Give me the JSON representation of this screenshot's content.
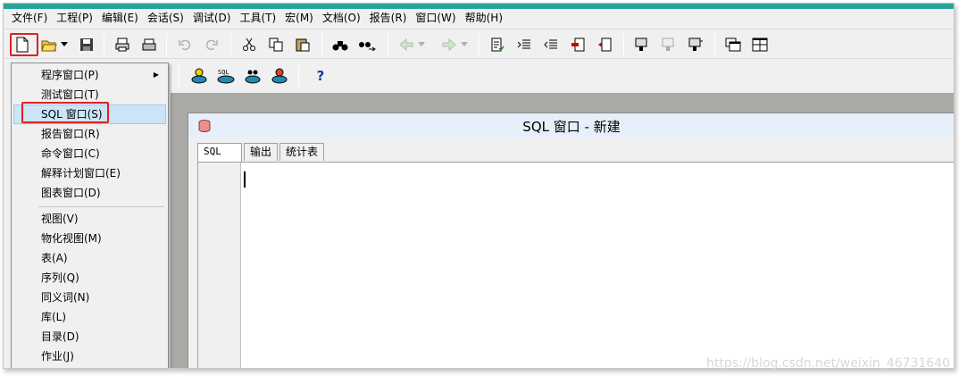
{
  "menubar": {
    "items": [
      "文件(F)",
      "工程(P)",
      "编辑(E)",
      "会话(S)",
      "调试(D)",
      "工具(T)",
      "宏(M)",
      "文档(O)",
      "报告(R)",
      "窗口(W)",
      "帮助(H)"
    ]
  },
  "dropdown": {
    "items": [
      {
        "label": "程序窗口(P)",
        "submenu": "▶"
      },
      {
        "label": "测试窗口(T)"
      },
      {
        "label": "SQL 窗口(S)"
      },
      {
        "label": "报告窗口(R)"
      },
      {
        "label": "命令窗口(C)"
      },
      {
        "label": "解释计划窗口(E)"
      },
      {
        "label": "图表窗口(D)"
      },
      {
        "label": "视图(V)"
      },
      {
        "label": "物化视图(M)"
      },
      {
        "label": "表(A)"
      },
      {
        "label": "序列(Q)"
      },
      {
        "label": "同义词(N)"
      },
      {
        "label": "库(L)"
      },
      {
        "label": "目录(D)"
      },
      {
        "label": "作业(J)"
      }
    ]
  },
  "sql_window": {
    "title": "SQL 窗口 - 新建",
    "tabs": [
      "SQL",
      "输出",
      "统计表"
    ]
  },
  "toolbar2": {
    "help_label": "?"
  },
  "watermark": "https://blog.csdn.net/weixin_46731640",
  "colors": {
    "accent": "#27a59a",
    "highlight": "#cce4f7",
    "annotation_red": "#e02020"
  }
}
